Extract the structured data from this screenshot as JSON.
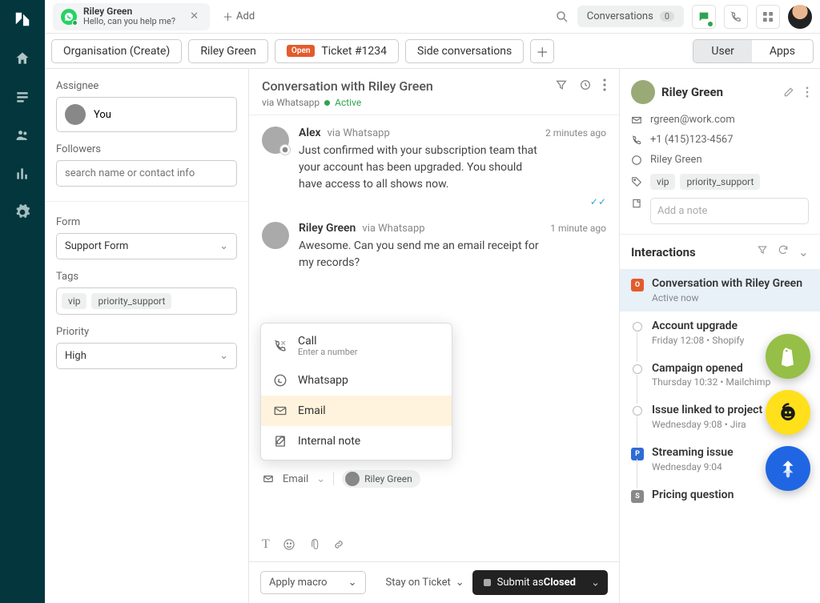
{
  "topbar": {
    "active_tab": {
      "title": "Riley Green",
      "subtitle": "Hello, can you help me?"
    },
    "add_label": "Add",
    "conv_label": "Conversations",
    "conv_count": "0"
  },
  "pagetabs": {
    "t0": "Organisation (Create)",
    "t1": "Riley Green",
    "t2_badge": "Open",
    "t2": "Ticket #1234",
    "t3": "Side conversations",
    "right0": "User",
    "right1": "Apps"
  },
  "fields": {
    "assignee_label": "Assignee",
    "assignee_value": "You",
    "followers_label": "Followers",
    "followers_ph": "search name or contact info",
    "form_label": "Form",
    "form_value": "Support Form",
    "tags_label": "Tags",
    "tag0": "vip",
    "tag1": "priority_support",
    "priority_label": "Priority",
    "priority_value": "High"
  },
  "conv": {
    "title": "Conversation with Riley Green",
    "via": "via Whatsapp",
    "status": "Active",
    "m0": {
      "name": "Alex",
      "via": "via Whatsapp",
      "time": "2 minutes ago",
      "body": "Just confirmed with your subscription team that your account has been upgraded. You should have access to all shows now."
    },
    "m1": {
      "name": "Riley Green",
      "via": "via Whatsapp",
      "time": "1 minute ago",
      "body": "Awesome. Can you send me an email receipt for my records?"
    },
    "channels": {
      "call": "Call",
      "call_sub": "Enter a number",
      "whatsapp": "Whatsapp",
      "email": "Email",
      "note": "Internal note"
    },
    "compose_channel": "Email",
    "compose_to": "Riley Green"
  },
  "footer": {
    "macro": "Apply macro",
    "stay": "Stay on Ticket",
    "submit_prefix": "Submit as ",
    "submit_state": "Closed"
  },
  "user": {
    "name": "Riley Green",
    "email": "rgreen@work.com",
    "phone": "+1 (415)123-4567",
    "whatsapp": "Riley Green",
    "tag0": "vip",
    "tag1": "priority_support",
    "note_ph": "Add a note"
  },
  "interactions": {
    "title": "Interactions",
    "i0": {
      "title": "Conversation with Riley Green",
      "sub": "Active now",
      "color": "#e35b2c",
      "letter": "O"
    },
    "i1": {
      "title": "Account upgrade",
      "sub": "Friday 12:08 • Shopify"
    },
    "i2": {
      "title": "Campaign opened",
      "sub": "Thursday 10:32 • Mailchimp"
    },
    "i3": {
      "title": "Issue linked to project",
      "sub": "Wednesday 9:08 • Jira"
    },
    "i4": {
      "title": "Streaming issue",
      "sub": "Wednesday 9:04",
      "color": "#2f6bd6",
      "letter": "P"
    },
    "i5": {
      "title": "Pricing question",
      "color": "#888",
      "letter": "S"
    }
  }
}
